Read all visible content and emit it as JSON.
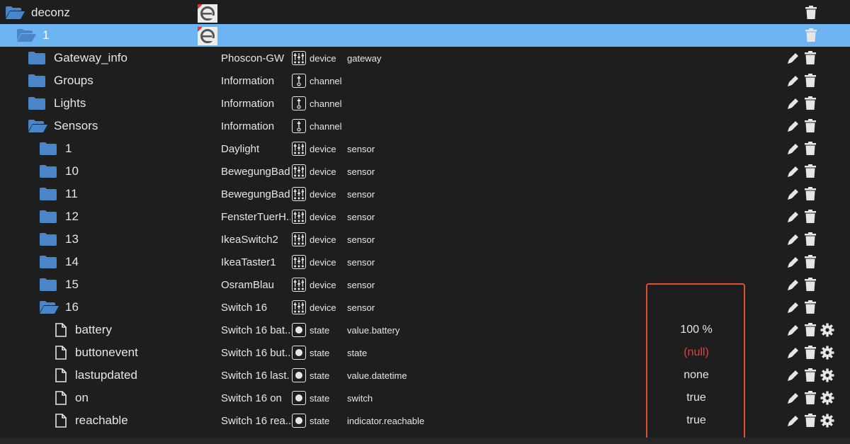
{
  "tree": {
    "rows": [
      {
        "name": "deconz",
        "indent": 8,
        "folder": "open",
        "logo": true,
        "actions": [
          "delete"
        ]
      },
      {
        "name": "1",
        "indent": 24,
        "folder": "open",
        "logo": true,
        "selected": true,
        "actions": [
          "delete"
        ]
      },
      {
        "name": "Gateway_info",
        "indent": 40,
        "folder": "closed",
        "objname": "Phoscon-GW",
        "type_icon": "device",
        "type": "device",
        "role": "gateway",
        "actions": [
          "edit",
          "delete"
        ]
      },
      {
        "name": "Groups",
        "indent": 40,
        "folder": "closed",
        "objname": "Information",
        "type_icon": "channel",
        "type": "channel",
        "actions": [
          "edit",
          "delete"
        ]
      },
      {
        "name": "Lights",
        "indent": 40,
        "folder": "closed",
        "objname": "Information",
        "type_icon": "channel",
        "type": "channel",
        "actions": [
          "edit",
          "delete"
        ]
      },
      {
        "name": "Sensors",
        "indent": 40,
        "folder": "open",
        "objname": "Information",
        "type_icon": "channel",
        "type": "channel",
        "actions": [
          "edit",
          "delete"
        ]
      },
      {
        "name": "1",
        "indent": 56,
        "folder": "closed",
        "objname": "Daylight",
        "type_icon": "device",
        "type": "device",
        "role": "sensor",
        "actions": [
          "edit",
          "delete"
        ]
      },
      {
        "name": "10",
        "indent": 56,
        "folder": "closed",
        "objname": "BewegungBad",
        "type_icon": "device",
        "type": "device",
        "role": "sensor",
        "actions": [
          "edit",
          "delete"
        ]
      },
      {
        "name": "11",
        "indent": 56,
        "folder": "closed",
        "objname": "BewegungBad",
        "type_icon": "device",
        "type": "device",
        "role": "sensor",
        "actions": [
          "edit",
          "delete"
        ]
      },
      {
        "name": "12",
        "indent": 56,
        "folder": "closed",
        "objname": "FensterTuerH...",
        "type_icon": "device",
        "type": "device",
        "role": "sensor",
        "actions": [
          "edit",
          "delete"
        ]
      },
      {
        "name": "13",
        "indent": 56,
        "folder": "closed",
        "objname": "IkeaSwitch2",
        "type_icon": "device",
        "type": "device",
        "role": "sensor",
        "actions": [
          "edit",
          "delete"
        ]
      },
      {
        "name": "14",
        "indent": 56,
        "folder": "closed",
        "objname": "IkeaTaster1",
        "type_icon": "device",
        "type": "device",
        "role": "sensor",
        "actions": [
          "edit",
          "delete"
        ]
      },
      {
        "name": "15",
        "indent": 56,
        "folder": "closed",
        "objname": "OsramBlau",
        "type_icon": "device",
        "type": "device",
        "role": "sensor",
        "actions": [
          "edit",
          "delete"
        ]
      },
      {
        "name": "16",
        "indent": 56,
        "folder": "open",
        "objname": "Switch 16",
        "type_icon": "device",
        "type": "device",
        "role": "sensor",
        "actions": [
          "edit",
          "delete"
        ]
      },
      {
        "name": "battery",
        "indent": 78,
        "file": true,
        "objname": "Switch 16 bat...",
        "type_icon": "state",
        "type": "state",
        "role": "value.battery",
        "value": "100 %",
        "actions": [
          "edit",
          "delete",
          "settings"
        ]
      },
      {
        "name": "buttonevent",
        "indent": 78,
        "file": true,
        "objname": "Switch 16 but...",
        "type_icon": "state",
        "type": "state",
        "role": "state",
        "value": "(null)",
        "value_null": true,
        "actions": [
          "edit",
          "delete",
          "settings"
        ]
      },
      {
        "name": "lastupdated",
        "indent": 78,
        "file": true,
        "objname": "Switch 16 last...",
        "type_icon": "state",
        "type": "state",
        "role": "value.datetime",
        "value": "none",
        "actions": [
          "edit",
          "delete",
          "settings"
        ]
      },
      {
        "name": "on",
        "indent": 78,
        "file": true,
        "objname": "Switch 16 on",
        "type_icon": "state",
        "type": "state",
        "role": "switch",
        "value": "true",
        "actions": [
          "edit",
          "delete",
          "settings"
        ]
      },
      {
        "name": "reachable",
        "indent": 78,
        "file": true,
        "objname": "Switch 16 rea...",
        "type_icon": "state",
        "type": "state",
        "role": "indicator.reachable",
        "value": "true",
        "actions": [
          "edit",
          "delete",
          "settings"
        ]
      }
    ]
  },
  "colors": {
    "background": "#1e1e1e",
    "selected_row": "#6cb4f2",
    "folder": "#4a86c5",
    "null_value": "#e14040",
    "highlight_border": "#e0502e"
  },
  "icons": {
    "folder_closed": "folder-icon",
    "folder_open": "folder-open-icon",
    "file": "file-icon",
    "edit": "pencil-icon",
    "delete": "trash-icon",
    "settings": "gear-icon",
    "device": "device-sliders-icon",
    "channel": "channel-icon",
    "state": "state-dot-icon",
    "logo": "adapter-logo-e"
  }
}
